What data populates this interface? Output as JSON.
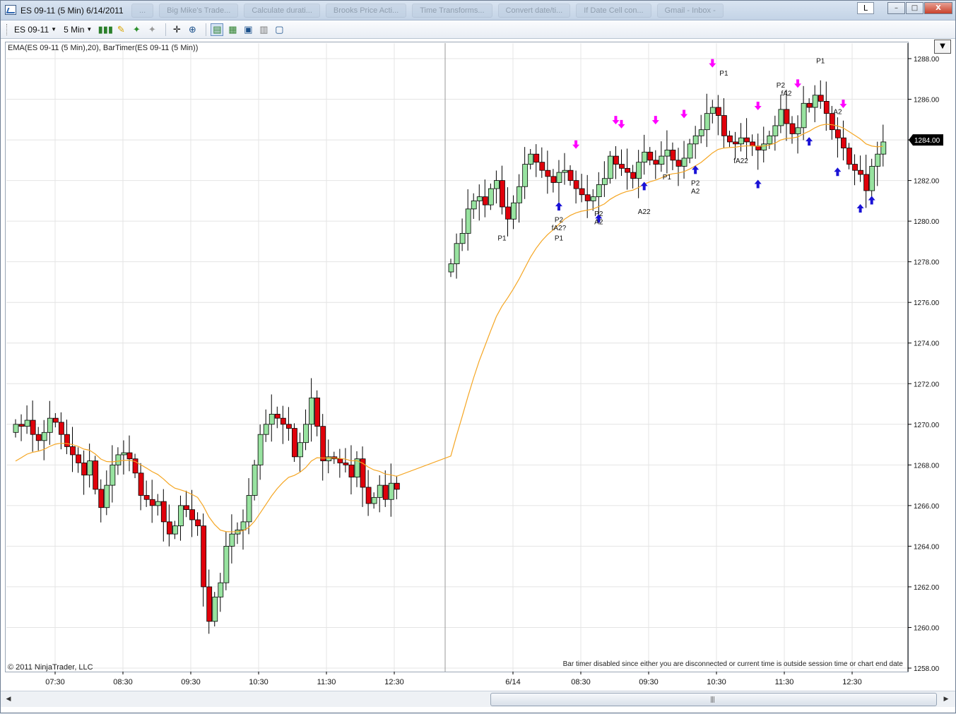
{
  "window": {
    "title": "ES 09-11 (5 Min)  6/14/2011",
    "ghost_tabs": [
      "...",
      "Big Mike's Trade...",
      "Calculate durati...",
      "Brooks Price Acti...",
      "Time Transforms...",
      "Convert date/ti...",
      "If Date Cell con...",
      "Gmail - Inbox -"
    ],
    "link_button": "L",
    "buttons": {
      "minimize": "–",
      "maximize": "□",
      "close": "X"
    }
  },
  "toolbar": {
    "instrument": "ES 09-11",
    "interval": "5 Min",
    "icons": [
      "bar-style-icon",
      "drawing-tool-icon",
      "add-indicator-icon",
      "strategy-icon",
      "crosshair-icon",
      "zoom-icon",
      "data-box-icon",
      "chart-style-icon",
      "properties-icon",
      "print-icon",
      "tile-icon"
    ]
  },
  "chart": {
    "indicator_label": "EMA(ES 09-11 (5 Min),20), BarTimer(ES 09-11 (5 Min))",
    "copyright": "© 2011 NinjaTrader, LLC",
    "bartimer_message": "Bar timer disabled since either you are disconnected or current time is outside session time or chart end date",
    "last_price_label": "1284.00",
    "colors": {
      "up": "#98e3a0",
      "down": "#e0000b",
      "wick": "#000000",
      "ema": "#f5a623",
      "buy_arrow": "#1a12d6",
      "sell_arrow": "#ff00ff",
      "grid": "#e4e4e4"
    }
  },
  "chart_data": {
    "type": "candlestick",
    "ylim": [
      1258,
      1288.5
    ],
    "yticks": [
      "1288.00",
      "1286.00",
      "1284.00",
      "1282.00",
      "1280.00",
      "1278.00",
      "1276.00",
      "1274.00",
      "1272.00",
      "1270.00",
      "1268.00",
      "1266.00",
      "1264.00",
      "1262.00",
      "1260.00",
      "1258.00"
    ],
    "xticks": [
      "07:30",
      "08:30",
      "09:30",
      "10:30",
      "11:30",
      "12:30",
      "6/14",
      "08:30",
      "09:30",
      "10:30",
      "11:30",
      "12:30"
    ],
    "ema_label": "EMA(20)",
    "session1_closes": [
      1270,
      1269.9,
      1270.2,
      1269.5,
      1269.2,
      1269.6,
      1270.3,
      1270.1,
      1269.5,
      1268.9,
      1268.5,
      1268.1,
      1267.5,
      1268.2,
      1266.8,
      1265.9,
      1267.0,
      1268.0,
      1268.5,
      1268.6,
      1268.3,
      1267.6,
      1266.5,
      1266.3,
      1266.0,
      1266.2,
      1265.2,
      1264.6,
      1265.0,
      1266.0,
      1265.8,
      1265.3,
      1265.0,
      1262.0,
      1260.3,
      1261.5,
      1262.2,
      1264.0,
      1264.6,
      1264.8,
      1265.2,
      1266.5,
      1268.0,
      1269.5,
      1270.0,
      1270.5,
      1270.3,
      1270.0,
      1269.8,
      1268.4,
      1269.1,
      1270.0,
      1271.3,
      1269.9,
      1268.2,
      1268.4,
      1268.3,
      1268.1,
      1268.0,
      1267.4,
      1268.3,
      1266.9,
      1266.1,
      1266.4,
      1267.0,
      1266.3,
      1267.1,
      1266.8
    ],
    "session2_closes": [
      1277.9,
      1278.9,
      1279.4,
      1280.6,
      1281.0,
      1281.2,
      1280.8,
      1281.6,
      1282.0,
      1280.7,
      1280.1,
      1280.9,
      1281.7,
      1282.8,
      1283.3,
      1282.9,
      1282.5,
      1282.2,
      1281.9,
      1282.4,
      1282.5,
      1282.0,
      1281.6,
      1281.3,
      1281.0,
      1281.2,
      1281.8,
      1282.1,
      1283.2,
      1282.8,
      1282.6,
      1282.4,
      1282.1,
      1282.9,
      1283.4,
      1283.0,
      1282.8,
      1283.2,
      1283.5,
      1283.0,
      1282.7,
      1283.1,
      1283.8,
      1284.2,
      1284.5,
      1285.3,
      1285.6,
      1285.2,
      1284.2,
      1283.9,
      1283.8,
      1284.1,
      1283.9,
      1283.7,
      1283.5,
      1283.8,
      1284.2,
      1284.7,
      1285.5,
      1284.8,
      1284.3,
      1284.6,
      1285.8,
      1285.6,
      1286.2,
      1285.9,
      1285.3,
      1284.5,
      1284.1,
      1283.6,
      1282.8,
      1282.5,
      1282.3,
      1281.5,
      1282.7,
      1283.3,
      1283.9
    ],
    "annotations": [
      {
        "text": "P1",
        "bar": 9,
        "price": 1279.4,
        "anchor": "below"
      },
      {
        "text": "P2",
        "bar": 19,
        "price": 1280.3,
        "anchor": "below"
      },
      {
        "text": "fA2?",
        "bar": 19,
        "price": 1279.9,
        "anchor": "below"
      },
      {
        "text": "P1",
        "bar": 19,
        "price": 1279.4,
        "anchor": "below"
      },
      {
        "text": "P2",
        "bar": 26,
        "price": 1280.6,
        "anchor": "below"
      },
      {
        "text": "A2",
        "bar": 26,
        "price": 1280.2,
        "anchor": "below"
      },
      {
        "text": "A22",
        "bar": 34,
        "price": 1280.7,
        "anchor": "below"
      },
      {
        "text": "P1",
        "bar": 38,
        "price": 1282.4,
        "anchor": "below"
      },
      {
        "text": "P2",
        "bar": 43,
        "price": 1282.1,
        "anchor": "below"
      },
      {
        "text": "A2",
        "bar": 43,
        "price": 1281.7,
        "anchor": "below"
      },
      {
        "text": "P1",
        "bar": 48,
        "price": 1287.1,
        "anchor": "above"
      },
      {
        "text": "fA22",
        "bar": 51,
        "price": 1283.2,
        "anchor": "below"
      },
      {
        "text": "P2",
        "bar": 58,
        "price": 1286.5,
        "anchor": "above"
      },
      {
        "text": "fA2",
        "bar": 59,
        "price": 1286.1,
        "anchor": "above"
      },
      {
        "text": "P1",
        "bar": 65,
        "price": 1287.7,
        "anchor": "above"
      },
      {
        "text": "A2",
        "bar": 68,
        "price": 1285.2,
        "anchor": "above"
      }
    ]
  }
}
